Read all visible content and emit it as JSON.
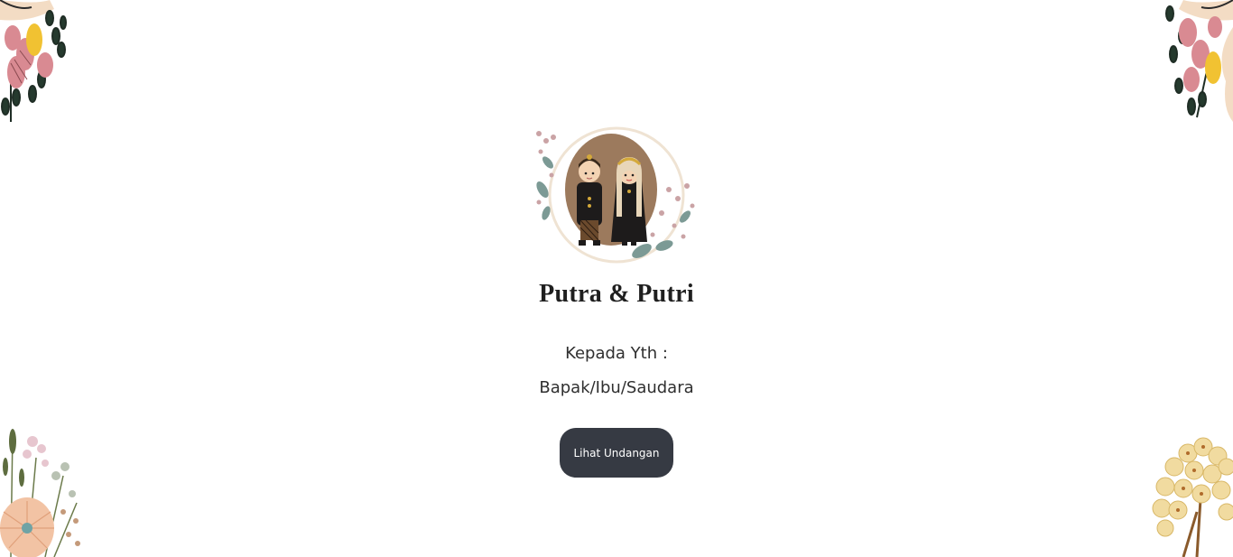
{
  "couple": {
    "title": "Putra & Putri",
    "image_icon": "bride-groom-illustration"
  },
  "recipient": {
    "label": "Kepada Yth :",
    "name": "Bapak/Ibu/Saudara"
  },
  "actions": {
    "open_invitation_label": "Lihat Undangan"
  },
  "decorations": {
    "top_left": "floral-corner-icon",
    "top_right": "floral-corner-icon",
    "bottom_left": "floral-corner-icon",
    "bottom_right": "floral-corner-icon"
  },
  "colors": {
    "button_bg": "#363a43",
    "button_text": "#ffffff",
    "title_text": "#1f1f1f",
    "body_text": "#2f2f2f"
  }
}
